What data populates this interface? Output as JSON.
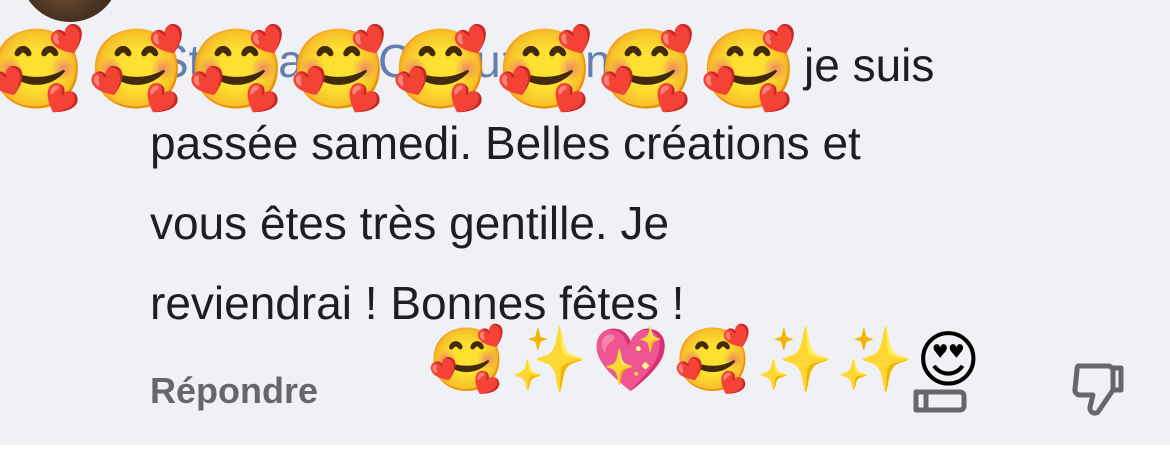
{
  "comment": {
    "mention_text": "Stéphanie Coutuziannia",
    "line1_tail": "je suis",
    "body_lines": [
      "passée samedi. Belles créations et",
      "vous êtes très gentille. Je",
      "reviendrai ! Bonnes fêtes !"
    ],
    "leading_emojis": [
      "🥰",
      "🥰",
      "🥰",
      "🥰",
      "🥰",
      "🥰",
      "🥰",
      "🥰"
    ],
    "trailing_emojis": [
      "🥰",
      "✨",
      "💖",
      "🥰",
      "✨",
      "✨",
      "😍"
    ]
  },
  "actions": {
    "reply_label": "Répondre"
  },
  "icons": {
    "like": "thumbs-up-icon",
    "dislike": "thumbs-down-icon"
  },
  "colors": {
    "bubble_bg": "#eff1f4",
    "text": "#1c1e21",
    "mention": "#385898",
    "secondary": "#65676b"
  }
}
